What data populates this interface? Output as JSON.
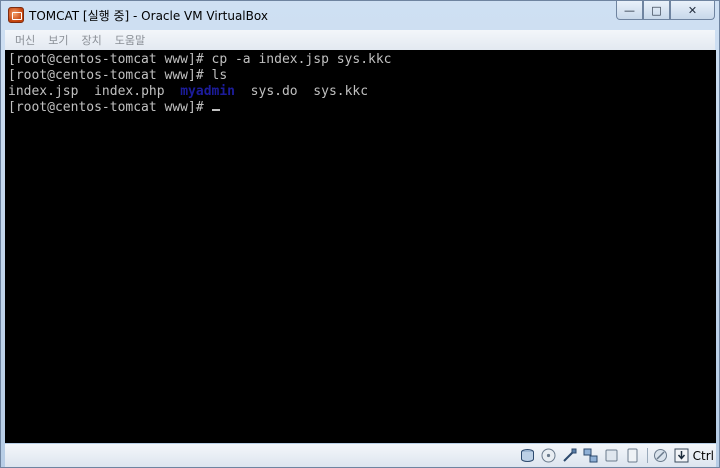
{
  "window": {
    "title": "TOMCAT [실행 중] - Oracle VM VirtualBox",
    "controls": {
      "minimize": "—",
      "maximize": "□",
      "close": "✕"
    }
  },
  "menubar": {
    "items": [
      {
        "label": "머신"
      },
      {
        "label": "보기"
      },
      {
        "label": "장치"
      },
      {
        "label": "도움말"
      }
    ]
  },
  "console": {
    "prompt": "[root@centos-tomcat www]# ",
    "lines": [
      {
        "prompt": "[root@centos-tomcat www]# ",
        "command": "cp -a index.jsp sys.kkc"
      },
      {
        "prompt": "[root@centos-tomcat www]# ",
        "command": "ls"
      },
      {
        "files": [
          "index.jsp",
          "index.php",
          "myadmin",
          "sys.do",
          "sys.kkc"
        ],
        "directories": [
          "myadmin"
        ]
      },
      {
        "prompt": "[root@centos-tomcat www]# ",
        "command": ""
      }
    ],
    "colors": {
      "background": "#000000",
      "text": "#c0c0c0",
      "directory": "#1c1c9c"
    }
  },
  "statusbar": {
    "icons": [
      "hard-disk-icon",
      "optical-drive-icon",
      "usb-icon",
      "network-icon",
      "shared-folder-icon",
      "display-icon",
      "mouse-integration-icon",
      "keyboard-capture-icon"
    ],
    "host_key": "Ctrl"
  }
}
